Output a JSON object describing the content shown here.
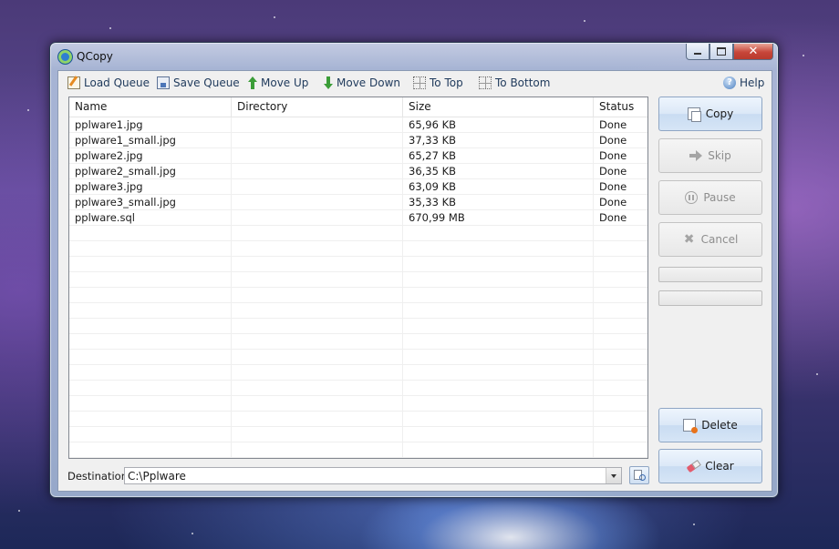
{
  "window": {
    "title": "QCopy",
    "controls": {
      "minimize": "minimize",
      "maximize": "maximize",
      "close": "✕"
    }
  },
  "toolbar": {
    "load_queue": "Load Queue",
    "save_queue": "Save Queue",
    "move_up": "Move Up",
    "move_down": "Move Down",
    "to_top": "To Top",
    "to_bottom": "To Bottom",
    "help": "Help"
  },
  "list": {
    "columns": [
      "Name",
      "Directory",
      "Size",
      "Status"
    ],
    "rows": [
      {
        "name": "pplware1.jpg",
        "directory": "",
        "size": "65,96 KB",
        "status": "Done"
      },
      {
        "name": "pplware1_small.jpg",
        "directory": "",
        "size": "37,33 KB",
        "status": "Done"
      },
      {
        "name": "pplware2.jpg",
        "directory": "",
        "size": "65,27 KB",
        "status": "Done"
      },
      {
        "name": "pplware2_small.jpg",
        "directory": "",
        "size": "36,35 KB",
        "status": "Done"
      },
      {
        "name": "pplware3.jpg",
        "directory": "",
        "size": "63,09 KB",
        "status": "Done"
      },
      {
        "name": "pplware3_small.jpg",
        "directory": "",
        "size": "35,33 KB",
        "status": "Done"
      },
      {
        "name": "pplware.sql",
        "directory": "",
        "size": "670,99 MB",
        "status": "Done"
      }
    ]
  },
  "actions": {
    "copy": "Copy",
    "skip": "Skip",
    "pause": "Pause",
    "cancel": "Cancel",
    "delete": "Delete",
    "clear": "Clear"
  },
  "progress": {
    "file_fraction": 0,
    "total_fraction": 0
  },
  "destination": {
    "label": "Destination:",
    "value": "C:\\Pplware"
  },
  "colors": {
    "progress_fill": "#06b025",
    "accent": "#1e395b"
  }
}
